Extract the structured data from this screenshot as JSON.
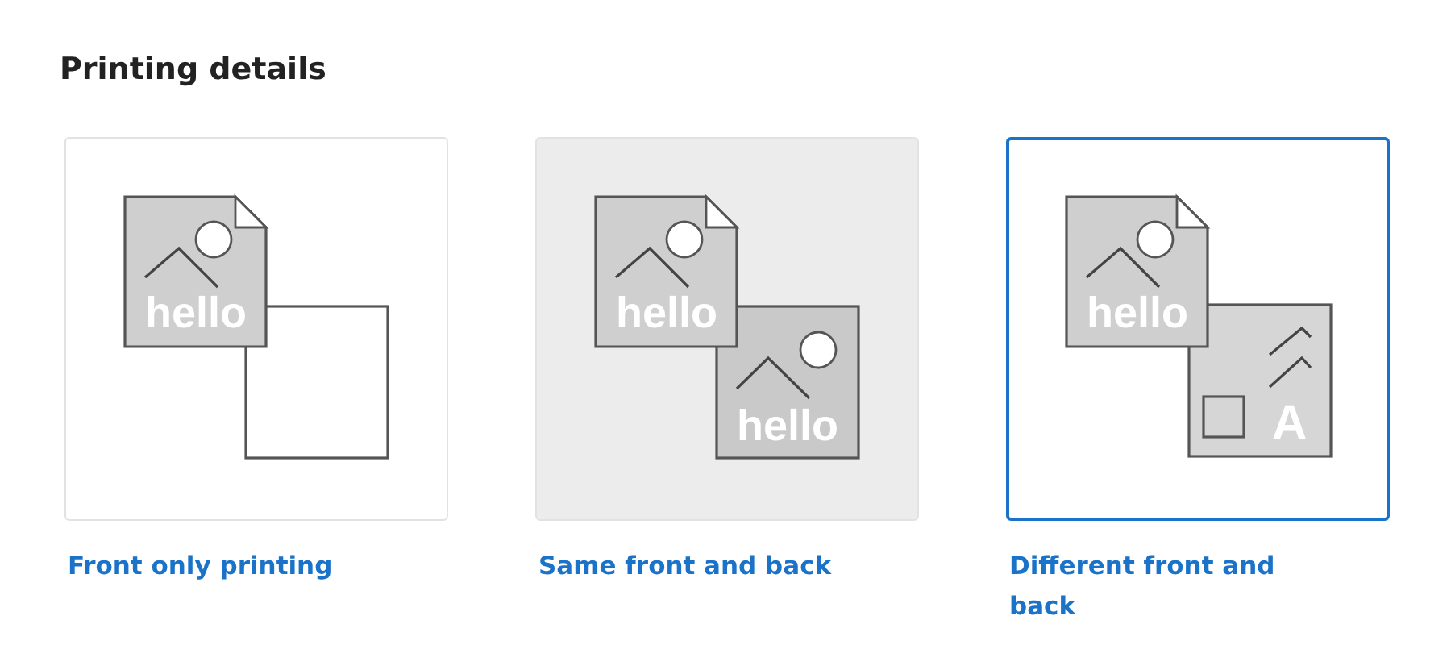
{
  "heading": "Printing details",
  "options": [
    {
      "label": "Front only printing",
      "selected": false,
      "highlighted": false,
      "kind": "blank",
      "front_text": "hello"
    },
    {
      "label": "Same front and back",
      "selected": false,
      "highlighted": true,
      "kind": "image",
      "front_text": "hello",
      "back_text": "hello"
    },
    {
      "label": "Different front and back",
      "selected": true,
      "highlighted": false,
      "kind": "layout",
      "front_text": "hello",
      "back_text": "A"
    }
  ]
}
